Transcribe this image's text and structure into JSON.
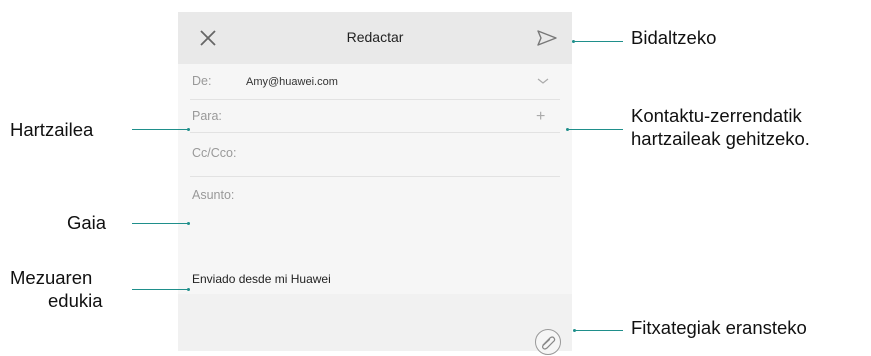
{
  "header": {
    "title": "Redactar"
  },
  "fields": {
    "from_label": "De:",
    "from_value": "Amy@huawei.com",
    "to_label": "Para:",
    "cc_label": "Cc/Cco:",
    "subject_label": "Asunto:"
  },
  "body": {
    "signature": "Enviado desde mi Huawei"
  },
  "annotations": {
    "send": "Bidaltzeko",
    "contacts_line1": "Kontaktu-zerrendatik",
    "contacts_line2": "hartzaileak gehitzeko.",
    "attach": "Fitxategiak eransteko",
    "recipient": "Hartzailea",
    "subject": "Gaia",
    "message_line1": "Mezuaren",
    "message_line2": "edukia"
  },
  "icons": [
    "close-icon",
    "send-icon",
    "chevron-down-icon",
    "plus-icon",
    "paperclip-icon"
  ],
  "colors": {
    "leader_line": "#1f8f8b",
    "topbar": "#e9e9e9"
  }
}
